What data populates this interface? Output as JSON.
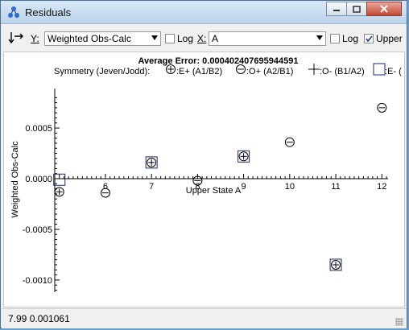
{
  "window": {
    "title": "Residuals"
  },
  "toolbar": {
    "y_label": "Y:",
    "y_select": "Weighted Obs-Calc",
    "y_log_label": "Log",
    "y_log_checked": false,
    "x_label": "X:",
    "x_select": "A",
    "x_log_label": "Log",
    "x_log_checked": false,
    "upper_label": "Upper",
    "upper_checked": true
  },
  "chart_data": {
    "type": "scatter",
    "title": "Average Error: 0.000402407695944591",
    "xlabel": "Upper State A",
    "ylabel": "Weighted Obs-Calc",
    "xlim": [
      4.9,
      12.1
    ],
    "ylim": [
      -0.00112,
      0.00085
    ],
    "x_ticks": [
      6,
      7,
      8,
      9,
      10,
      11,
      12
    ],
    "y_ticks": [
      {
        "value": 0.0005,
        "label": "0.0005"
      },
      {
        "value": 0.0,
        "label": "0.0000"
      },
      {
        "value": -0.0005,
        "label": "-0.0005"
      },
      {
        "value": -0.001,
        "label": "-0.0010"
      }
    ],
    "legend_title": "Symmetry (Jeven/Jodd):",
    "legend": [
      {
        "symbol": "circle-plus",
        "label": ":E+ (A1/B2)"
      },
      {
        "symbol": "circle-minus",
        "label": ":O+ (A2/B1)"
      },
      {
        "symbol": "plus",
        "label": ":O- (B1/A2)"
      },
      {
        "symbol": "square",
        "label": ":E- ("
      }
    ],
    "series": [
      {
        "symbol": "circle-plus",
        "points": [
          [
            5,
            -0.00013
          ]
        ]
      },
      {
        "symbol": "circle-minus",
        "points": [
          [
            6,
            -0.00014
          ],
          [
            8,
            -2e-05
          ],
          [
            10,
            0.00036
          ],
          [
            12,
            0.0007
          ]
        ]
      },
      {
        "symbol": "square",
        "points": [
          [
            5,
            -1e-05
          ]
        ]
      },
      {
        "symbol": "boxed-circle-plus",
        "points": [
          [
            7,
            0.00016
          ],
          [
            9,
            0.00022
          ],
          [
            11,
            -0.00085
          ]
        ]
      }
    ]
  },
  "statusbar": {
    "text": "7.99  0.001061"
  }
}
